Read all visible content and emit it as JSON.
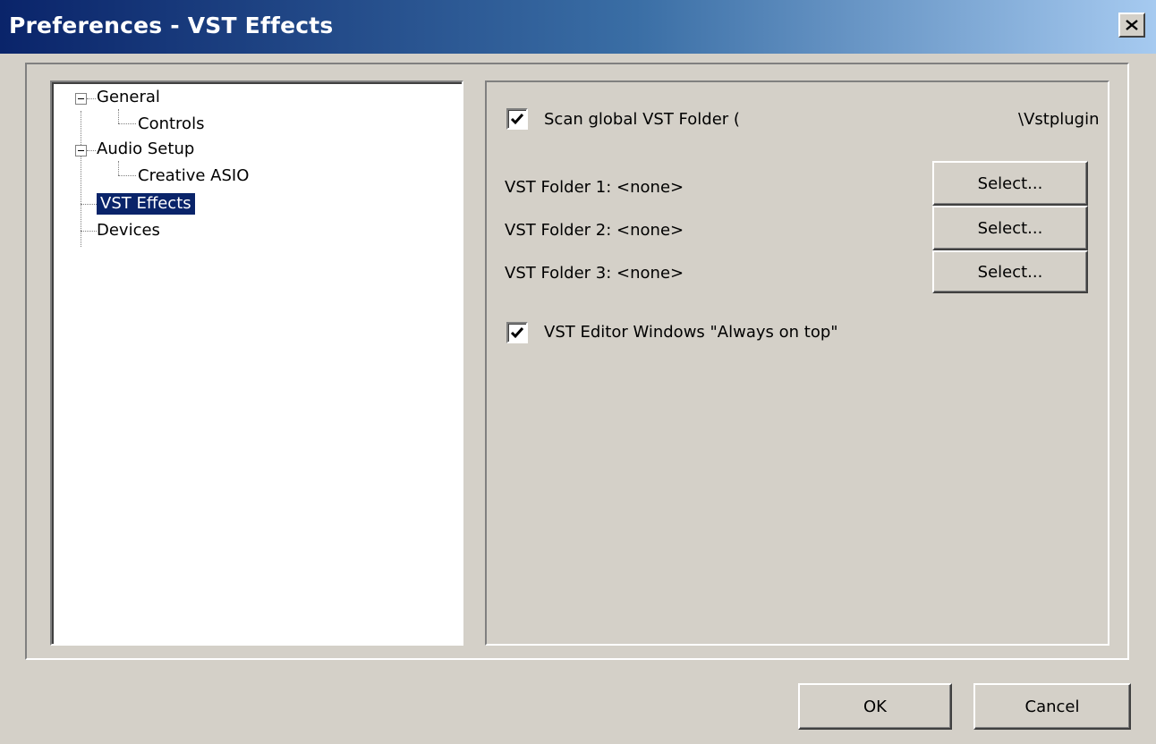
{
  "window": {
    "title": "Preferences - VST Effects",
    "close_icon": "close-icon"
  },
  "tree": {
    "items": [
      {
        "label": "General",
        "level": 0,
        "expanded": true
      },
      {
        "label": "Controls",
        "level": 1
      },
      {
        "label": "Audio Setup",
        "level": 0,
        "expanded": true
      },
      {
        "label": "Creative ASIO",
        "level": 1
      },
      {
        "label": "VST Effects",
        "level": 0,
        "selected": true
      },
      {
        "label": "Devices",
        "level": 0
      }
    ]
  },
  "vst": {
    "scan_global": {
      "label": "Scan global VST Folder (",
      "path_suffix": "\\Vstplugin",
      "checked": true
    },
    "folders": [
      {
        "label": "VST Folder 1: <none>",
        "button": "Select..."
      },
      {
        "label": "VST Folder 2: <none>",
        "button": "Select..."
      },
      {
        "label": "VST Folder 3: <none>",
        "button": "Select..."
      }
    ],
    "always_on_top": {
      "label": "VST Editor Windows \"Always on top\"",
      "checked": true
    }
  },
  "footer": {
    "ok": "OK",
    "cancel": "Cancel"
  },
  "colors": {
    "title_bar": "#0a246a",
    "selection": "#0a246a",
    "face": "#d4d0c8"
  }
}
